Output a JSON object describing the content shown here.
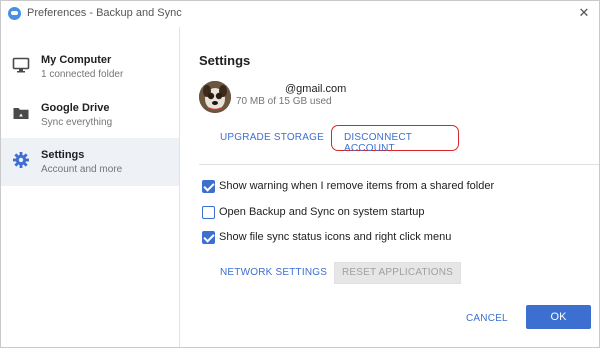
{
  "window": {
    "title": "Preferences - Backup and Sync",
    "close_symbol": "✕"
  },
  "sidebar": {
    "items": [
      {
        "title": "My Computer",
        "subtitle": "1 connected folder",
        "icon": "monitor-icon",
        "active": false
      },
      {
        "title": "Google Drive",
        "subtitle": "Sync everything",
        "icon": "drive-folder-icon",
        "active": false
      },
      {
        "title": "Settings",
        "subtitle": "Account and more",
        "icon": "gear-icon",
        "active": true
      }
    ]
  },
  "main": {
    "title": "Settings",
    "account": {
      "email": "@gmail.com",
      "usage": "70 MB of 15 GB used"
    },
    "upgrade_label": "UPGRADE STORAGE",
    "disconnect_label": "DISCONNECT ACCOUNT",
    "options": [
      {
        "label": "Show warning when I remove items from a shared folder",
        "checked": true
      },
      {
        "label": "Open Backup and Sync on system startup",
        "checked": false
      },
      {
        "label": "Show file sync status icons and right click menu",
        "checked": true
      }
    ],
    "network_label": "NETWORK SETTINGS",
    "reset_label": "RESET APPLICATIONS"
  },
  "footer": {
    "cancel_label": "CANCEL",
    "ok_label": "OK"
  },
  "colors": {
    "accent": "#3d6fd1",
    "highlight_ring": "#d6262b",
    "active_nav_bg": "#eef1f6"
  }
}
